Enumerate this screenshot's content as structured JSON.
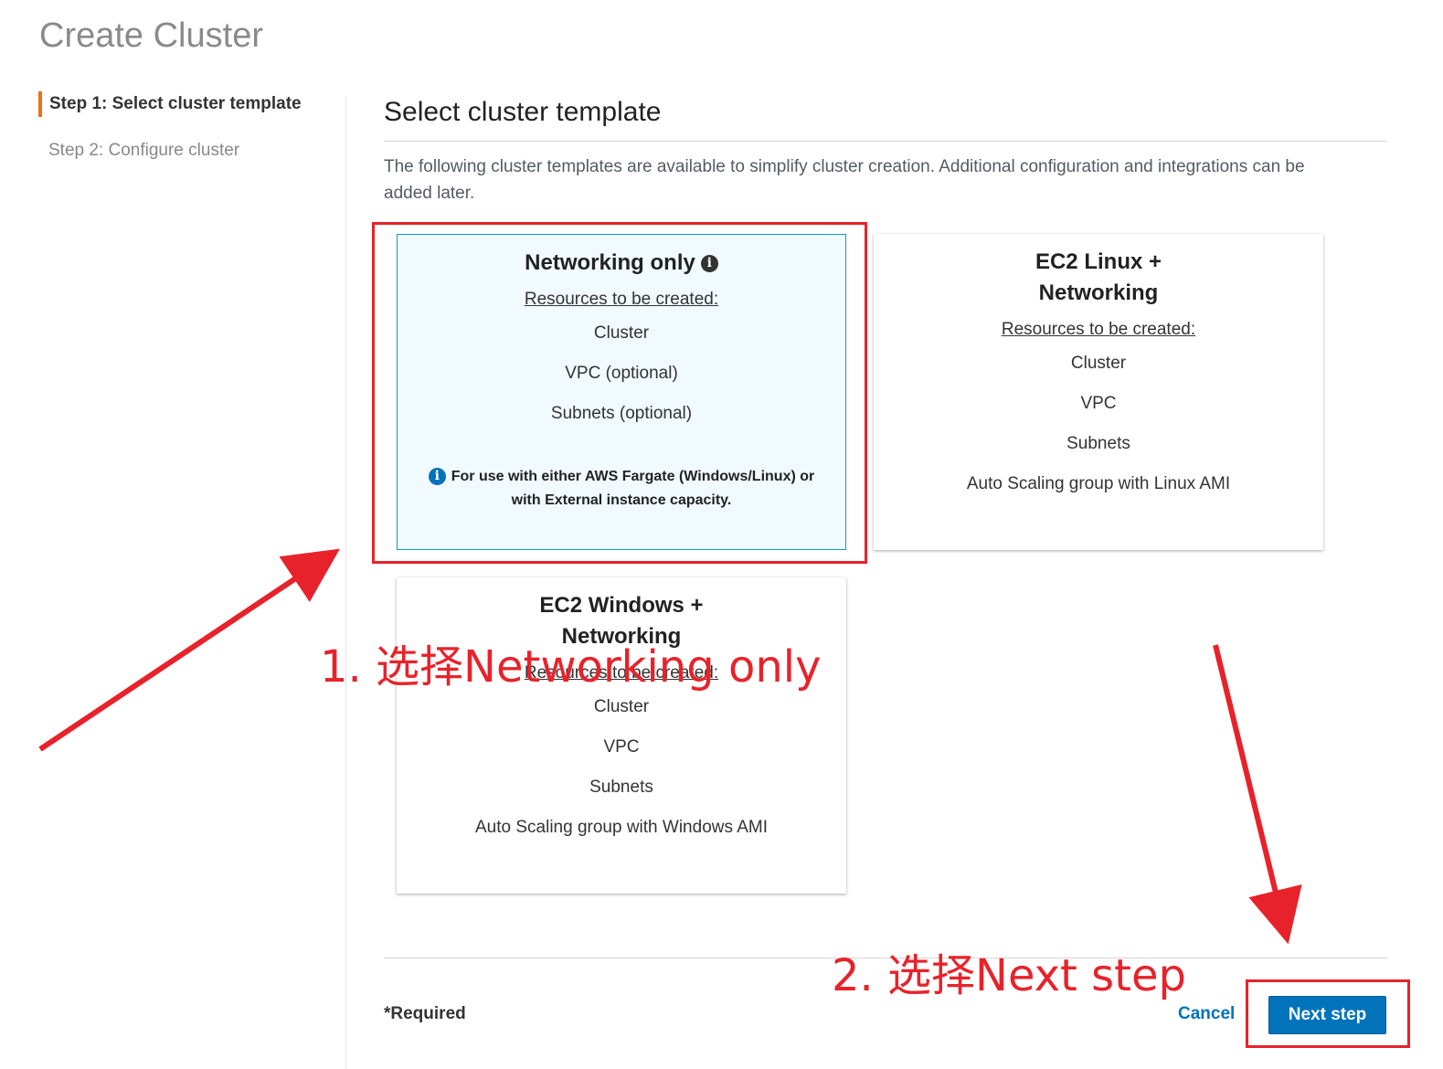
{
  "page": {
    "title": "Create Cluster"
  },
  "steps": [
    {
      "label": "Step 1: Select cluster template",
      "active": true
    },
    {
      "label": "Step 2: Configure cluster",
      "active": false
    }
  ],
  "section": {
    "title": "Select cluster template",
    "description": "The following cluster templates are available to simplify cluster creation. Additional configuration and integrations can be added later."
  },
  "cards": {
    "networking_only": {
      "title": "Networking only",
      "resources_heading": "Resources to be created:",
      "resources": [
        "Cluster",
        "VPC (optional)",
        "Subnets (optional)"
      ],
      "note": "For use with either AWS Fargate (Windows/Linux) or with External instance capacity.",
      "selected": true
    },
    "ec2_linux": {
      "title": "EC2 Linux + Networking",
      "resources_heading": "Resources to be created:",
      "resources": [
        "Cluster",
        "VPC",
        "Subnets",
        "Auto Scaling group with Linux AMI"
      ]
    },
    "ec2_windows": {
      "title": "EC2 Windows + Networking",
      "resources_heading": "Resources to be created:",
      "resources": [
        "Cluster",
        "VPC",
        "Subnets",
        "Auto Scaling group with Windows AMI"
      ]
    }
  },
  "footer": {
    "required_label": "*Required",
    "cancel_label": "Cancel",
    "next_label": "Next step"
  },
  "annotations": {
    "step1_text": "1. 选择Networking only",
    "step2_text": "2. 选择Next step",
    "color": "#e8222a"
  },
  "icons": {
    "info": "info-icon"
  },
  "colors": {
    "primary": "#0073bb",
    "step_accent": "#ec7211",
    "selected_card_bg": "#f1faff"
  }
}
